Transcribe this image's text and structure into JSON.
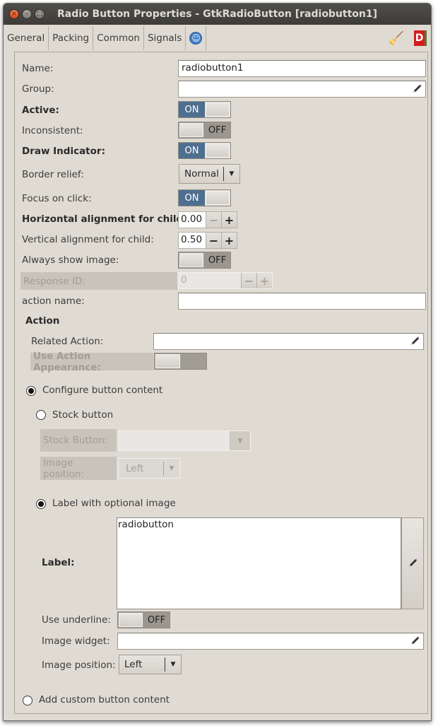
{
  "window": {
    "title": "Radio Button Properties - GtkRadioButton [radiobutton1]",
    "buttons": {
      "close": "×",
      "minimize": "–",
      "maximize": "□"
    }
  },
  "tabs": [
    {
      "label": "General",
      "active": true
    },
    {
      "label": "Packing",
      "active": false
    },
    {
      "label": "Common",
      "active": false
    },
    {
      "label": "Signals",
      "active": false
    },
    {
      "label": "accessibility-icon",
      "icon": true
    }
  ],
  "toolbar_icons": [
    "clear-broom-icon",
    "devhelp-book-icon"
  ],
  "toolbar_glyphs": {
    "acc": "☺",
    "broom": "🧹",
    "dbook": "D"
  },
  "props": {
    "name": {
      "label": "Name:",
      "value": "radiobutton1"
    },
    "group": {
      "label": "Group:",
      "value": ""
    },
    "active": {
      "label": "Active:",
      "state": "ON"
    },
    "inconsistent": {
      "label": "Inconsistent:",
      "state": "OFF"
    },
    "draw_indicator": {
      "label": "Draw Indicator:",
      "state": "ON"
    },
    "border_relief": {
      "label": "Border relief:",
      "value": "Normal"
    },
    "focus_on_click": {
      "label": "Focus on click:",
      "state": "ON"
    },
    "halign": {
      "label": "Horizontal alignment for child:",
      "value": "0.00"
    },
    "valign": {
      "label": "Vertical alignment for child:",
      "value": "0.50"
    },
    "always_show_image": {
      "label": "Always show image:",
      "state": "OFF"
    },
    "response_id": {
      "label": "Response ID:",
      "value": "0"
    },
    "action_name": {
      "label": "action name:",
      "value": ""
    }
  },
  "action": {
    "heading": "Action",
    "related_action": {
      "label": "Related Action:",
      "value": ""
    },
    "use_action_appearance": {
      "label": "Use Action Appearance:"
    }
  },
  "content": {
    "configure": {
      "label": "Configure button content",
      "selected": true
    },
    "stock": {
      "label": "Stock button",
      "selected": false
    },
    "stock_button": {
      "label": "Stock Button:",
      "value": ""
    },
    "stock_image_position": {
      "label": "Image position:",
      "value": "Left"
    },
    "label_opt": {
      "label": "Label with optional image",
      "selected": true
    },
    "label": {
      "label": "Label:",
      "value": "radiobutton"
    },
    "use_underline": {
      "label": "Use underline:",
      "state": "OFF"
    },
    "image_widget": {
      "label": "Image widget:",
      "value": ""
    },
    "image_position": {
      "label": "Image position:",
      "value": "Left"
    },
    "custom": {
      "label": "Add custom button content",
      "selected": false
    }
  },
  "spin": {
    "minus": "−",
    "plus": "+"
  },
  "combo_arrow": "▼",
  "colors": {
    "switch_on": "#4e6f8f",
    "switch_off": "#9c978e",
    "window_bg": "#dfdbd2"
  }
}
